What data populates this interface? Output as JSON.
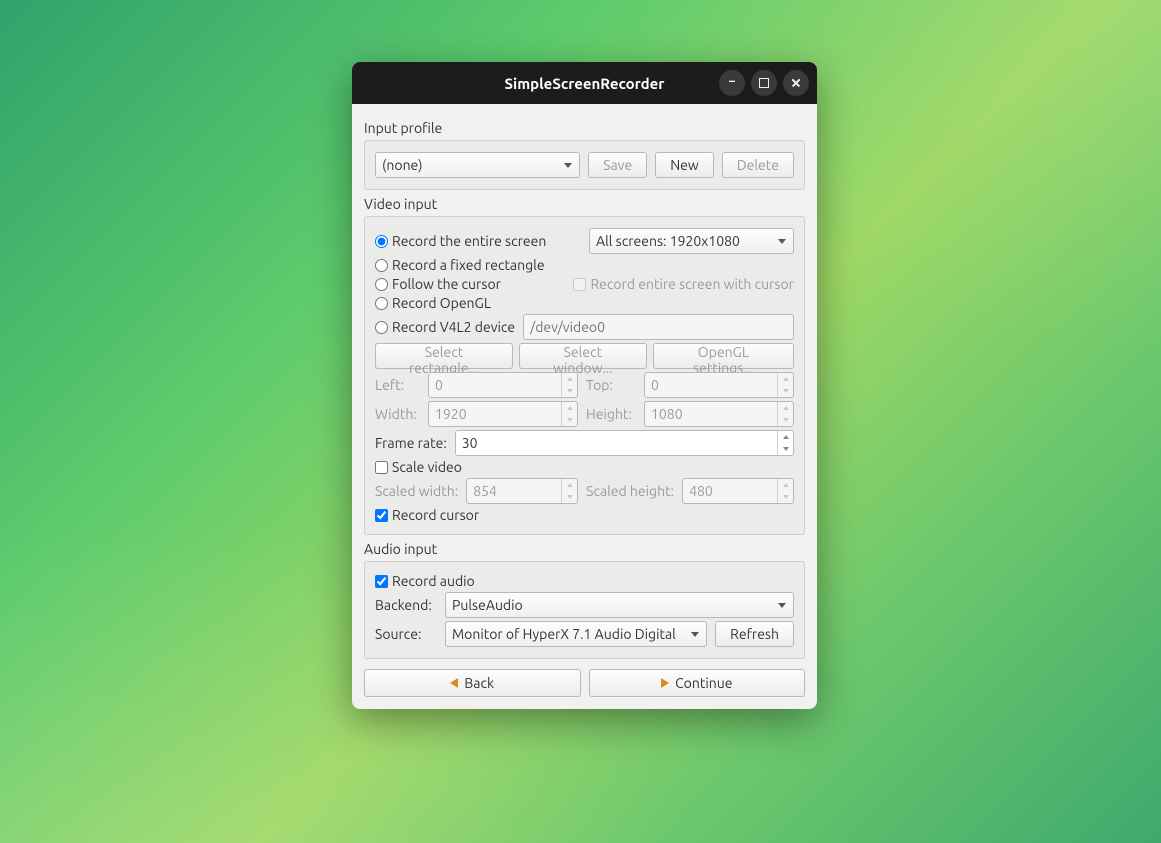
{
  "window": {
    "title": "SimpleScreenRecorder"
  },
  "input_profile": {
    "label": "Input profile",
    "selected": "(none)",
    "save": "Save",
    "new": "New",
    "delete": "Delete"
  },
  "video": {
    "label": "Video input",
    "opt_entire": "Record the entire screen",
    "screen_select": "All screens: 1920x1080",
    "opt_rect": "Record a fixed rectangle",
    "opt_follow": "Follow the cursor",
    "opt_followcb": "Record entire screen with cursor",
    "opt_opengl": "Record OpenGL",
    "opt_v4l2": "Record V4L2 device",
    "v4l2_placeholder": "/dev/video0",
    "btn_selrect": "Select rectangle...",
    "btn_selwin": "Select window...",
    "btn_oglset": "OpenGL settings...",
    "left_l": "Left:",
    "left_v": "0",
    "top_l": "Top:",
    "top_v": "0",
    "width_l": "Width:",
    "width_v": "1920",
    "height_l": "Height:",
    "height_v": "1080",
    "fr_l": "Frame rate:",
    "fr_v": "30",
    "scale_cb": "Scale video",
    "sw_l": "Scaled width:",
    "sw_v": "854",
    "sh_l": "Scaled height:",
    "sh_v": "480",
    "cursor_cb": "Record cursor"
  },
  "audio": {
    "label": "Audio input",
    "record_cb": "Record audio",
    "backend_l": "Backend:",
    "backend_v": "PulseAudio",
    "source_l": "Source:",
    "source_v": "Monitor of HyperX 7.1 Audio Digital",
    "refresh": "Refresh"
  },
  "footer": {
    "back": "Back",
    "continue": "Continue"
  }
}
